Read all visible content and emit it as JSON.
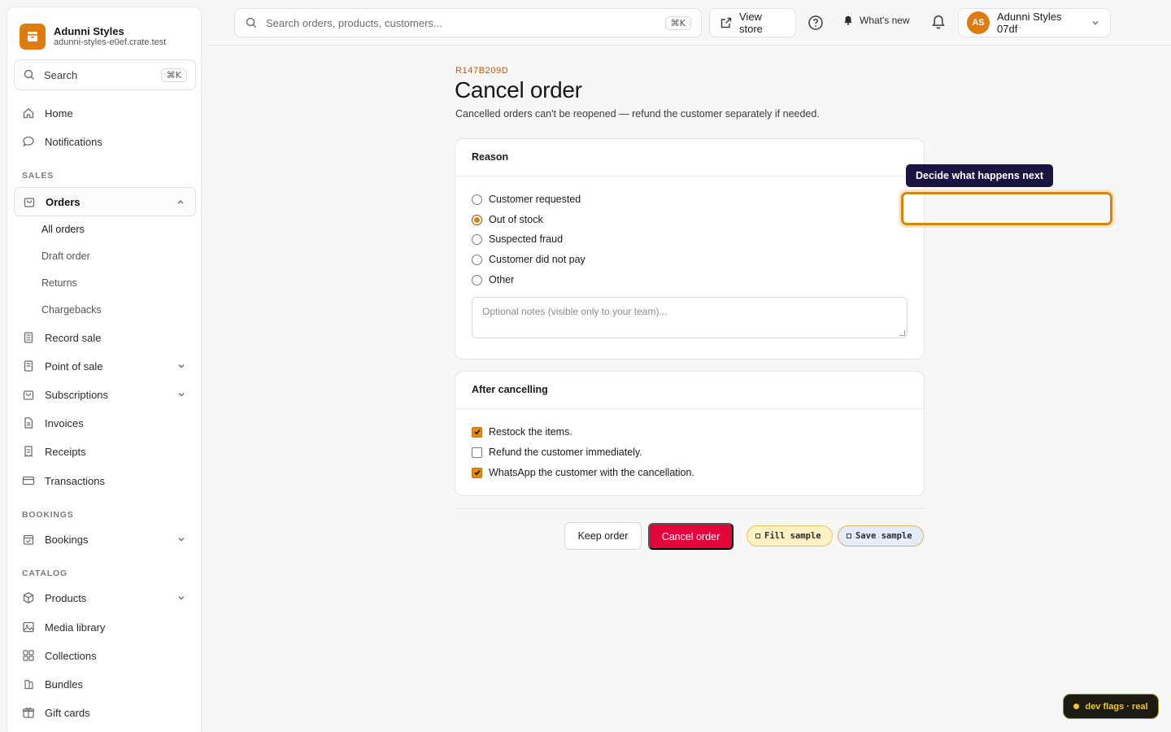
{
  "brand": {
    "name": "Adunni Styles",
    "domain": "adunni-styles-e0ef.crate.test"
  },
  "sidebar": {
    "search_label": "Search",
    "search_shortcut": "⌘K",
    "items": [
      {
        "label": "Home",
        "icon": "home-icon"
      },
      {
        "label": "Notifications",
        "icon": "chat-bubble-icon"
      }
    ],
    "sections": {
      "sales": "SALES",
      "bookings": "BOOKINGS",
      "catalog": "CATALOG"
    },
    "sales_items": {
      "orders": "Orders",
      "orders_sub": [
        "All orders",
        "Draft order",
        "Returns",
        "Chargebacks"
      ],
      "record_sale": "Record sale",
      "point_of_sale": "Point of sale",
      "subscriptions": "Subscriptions",
      "invoices": "Invoices",
      "receipts": "Receipts",
      "transactions": "Transactions"
    },
    "bookings_items": {
      "bookings": "Bookings"
    },
    "catalog_items": {
      "products": "Products",
      "media_library": "Media library",
      "collections": "Collections",
      "bundles": "Bundles",
      "gift_cards": "Gift cards"
    }
  },
  "topbar": {
    "search_placeholder": "Search orders, products, customers...",
    "search_shortcut": "⌘K",
    "view_store": "View store",
    "whats_new": "What's new",
    "account_initials": "AS",
    "account_name": "Adunni Styles 07df"
  },
  "page": {
    "order_id": "R147B209D",
    "title": "Cancel order",
    "subtitle": "Cancelled orders can't be reopened — refund the customer separately if needed."
  },
  "reason_card": {
    "heading": "Reason",
    "options": [
      "Customer requested",
      "Out of stock",
      "Suspected fraud",
      "Customer did not pay",
      "Other"
    ],
    "selected": "Out of stock",
    "notes_placeholder": "Optional notes (visible only to your team)..."
  },
  "after_card": {
    "heading": "After cancelling",
    "options": [
      {
        "label": "Restock the items.",
        "checked": true
      },
      {
        "label": "Refund the customer immediately.",
        "checked": false
      },
      {
        "label": "WhatsApp the customer with the cancellation.",
        "checked": true
      }
    ]
  },
  "actions": {
    "keep": "Keep order",
    "cancel": "Cancel order",
    "fill_sample": "Fill sample",
    "save_sample": "Save sample"
  },
  "tooltip": {
    "text": "Decide what happens next"
  },
  "dev_flags": {
    "label": "dev flags · real"
  },
  "colors": {
    "accent": "#e07b10",
    "danger": "#e5033c",
    "tooltip_bg": "#1b1340"
  }
}
